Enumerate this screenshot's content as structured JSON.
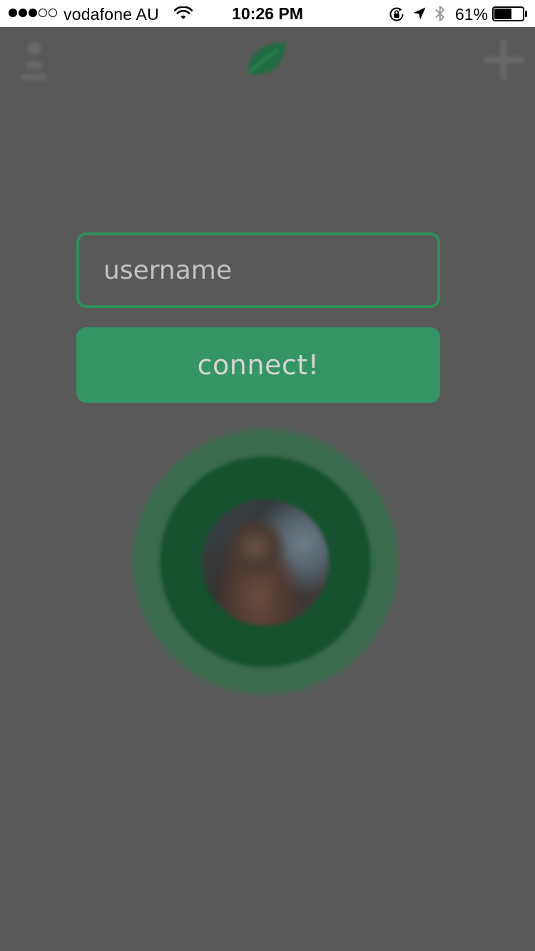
{
  "status_bar": {
    "signal_dots": [
      true,
      true,
      true,
      false,
      false
    ],
    "carrier": "vodafone AU",
    "time": "10:26 PM",
    "battery_percent_text": "61%",
    "battery_level": 0.61,
    "icons": [
      "wifi-icon",
      "lock-rotation-icon",
      "location-icon",
      "bluetooth-icon",
      "battery-icon"
    ]
  },
  "header": {
    "icons": [
      "profile-icon",
      "leaf-logo-icon",
      "add-icon"
    ]
  },
  "form": {
    "username_placeholder": "username",
    "username_value": "",
    "connect_label": "connect!"
  },
  "avatar": {
    "icon": "avatar"
  },
  "colors": {
    "overlay_background": "#595959",
    "brand_green": "#349466",
    "input_border": "#2f8e5c",
    "ring_outer": "#3b6b4f",
    "ring_inner": "#16522f",
    "status_bar_background": "#ffffff"
  }
}
